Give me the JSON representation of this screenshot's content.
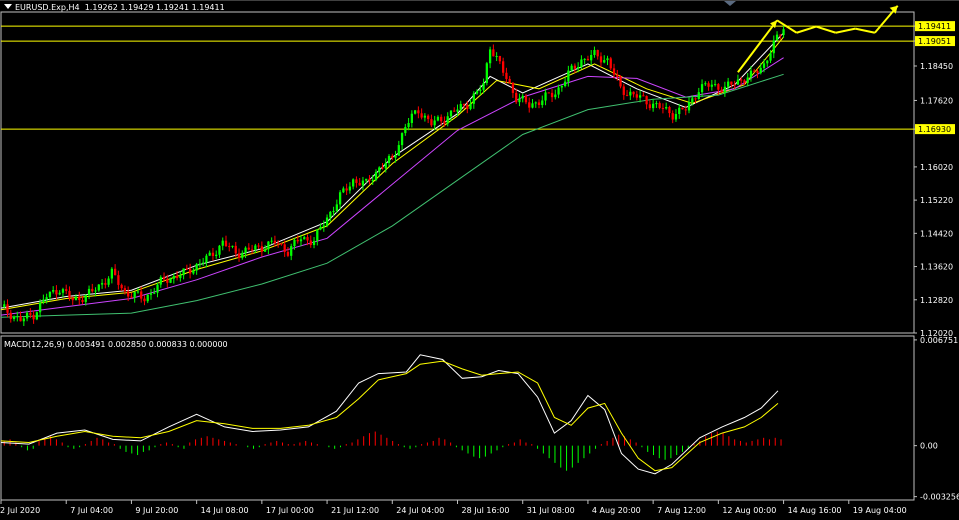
{
  "header": {
    "symbol": "EURUSD.Exp,H4",
    "ohlc": "1.19262 1.19429 1.19241 1.19411"
  },
  "macd_header": {
    "text": "MACD(12,26,9) 0.003491 0.002850 0.000833 0.000000"
  },
  "colors": {
    "background": "#000000",
    "bull": "#00ff00",
    "bear": "#ff0000",
    "ma_fast": "#ffffff",
    "ma_mid": "#ffff00",
    "ma_slow": "#cc44ff",
    "ma_long": "#40c070",
    "hline": "#ffff00",
    "price_label_bg": "#ffff00",
    "grid_frame": "#c0c0c0",
    "arrow": "#ffff00"
  },
  "chart_data": [
    {
      "type": "candlestick",
      "name": "price",
      "ylim": [
        1.1202,
        1.1975
      ],
      "y_ticks": [
        "1.19411",
        "1.19051",
        "1.18450",
        "1.17620",
        "1.16930",
        "1.16020",
        "1.15220",
        "1.14420",
        "1.13620",
        "1.12820",
        "1.12020"
      ],
      "x_tick_labels": [
        "2 Jul 2020",
        "7 Jul 04:00",
        "9 Jul 20:00",
        "14 Jul 08:00",
        "17 Jul 00:00",
        "21 Jul 12:00",
        "24 Jul 04:00",
        "28 Jul 16:00",
        "31 Jul 08:00",
        "4 Aug 20:00",
        "7 Aug 12:00",
        "12 Aug 00:00",
        "14 Aug 16:00",
        "19 Aug 04:00"
      ],
      "horizontal_lines": [
        1.1941,
        1.1905,
        1.1693
      ],
      "price_labels": [
        {
          "text": "1.19411",
          "value": 1.1941
        },
        {
          "text": "1.19051",
          "value": 1.1905
        },
        {
          "text": "1.16930",
          "value": 1.1693
        }
      ],
      "close_path": [
        [
          0,
          1.1265
        ],
        [
          6,
          1.1232
        ],
        [
          10,
          1.1248
        ],
        [
          14,
          1.129
        ],
        [
          18,
          1.131
        ],
        [
          22,
          1.128
        ],
        [
          28,
          1.13
        ],
        [
          34,
          1.1345
        ],
        [
          38,
          1.13
        ],
        [
          44,
          1.1285
        ],
        [
          50,
          1.133
        ],
        [
          56,
          1.1345
        ],
        [
          60,
          1.1365
        ],
        [
          64,
          1.1385
        ],
        [
          68,
          1.142
        ],
        [
          72,
          1.1395
        ],
        [
          78,
          1.1405
        ],
        [
          84,
          1.142
        ],
        [
          88,
          1.14
        ],
        [
          92,
          1.143
        ],
        [
          96,
          1.1425
        ],
        [
          100,
          1.148
        ],
        [
          104,
          1.153
        ],
        [
          108,
          1.157
        ],
        [
          112,
          1.156
        ],
        [
          116,
          1.16
        ],
        [
          120,
          1.162
        ],
        [
          124,
          1.17
        ],
        [
          128,
          1.174
        ],
        [
          132,
          1.1705
        ],
        [
          136,
          1.172
        ],
        [
          140,
          1.174
        ],
        [
          144,
          1.176
        ],
        [
          148,
          1.18
        ],
        [
          150,
          1.1895
        ],
        [
          154,
          1.183
        ],
        [
          158,
          1.177
        ],
        [
          162,
          1.175
        ],
        [
          166,
          1.1765
        ],
        [
          170,
          1.178
        ],
        [
          174,
          1.1825
        ],
        [
          178,
          1.186
        ],
        [
          182,
          1.187
        ],
        [
          186,
          1.186
        ],
        [
          190,
          1.179
        ],
        [
          194,
          1.1775
        ],
        [
          198,
          1.176
        ],
        [
          202,
          1.1745
        ],
        [
          206,
          1.173
        ],
        [
          210,
          1.174
        ],
        [
          214,
          1.179
        ],
        [
          218,
          1.18
        ],
        [
          222,
          1.179
        ],
        [
          226,
          1.181
        ],
        [
          230,
          1.182
        ],
        [
          234,
          1.185
        ],
        [
          236,
          1.188
        ],
        [
          240,
          1.1941
        ]
      ],
      "moving_averages": [
        {
          "role": "ma_fast",
          "points": [
            [
              0,
              1.1262
            ],
            [
              20,
              1.129
            ],
            [
              40,
              1.1305
            ],
            [
              60,
              1.1365
            ],
            [
              80,
              1.1405
            ],
            [
              100,
              1.147
            ],
            [
              120,
              1.1625
            ],
            [
              140,
              1.173
            ],
            [
              150,
              1.182
            ],
            [
              160,
              1.178
            ],
            [
              180,
              1.185
            ],
            [
              195,
              1.179
            ],
            [
              210,
              1.1745
            ],
            [
              225,
              1.18
            ],
            [
              240,
              1.1925
            ]
          ]
        },
        {
          "role": "ma_mid",
          "points": [
            [
              0,
              1.1258
            ],
            [
              20,
              1.1285
            ],
            [
              40,
              1.13
            ],
            [
              60,
              1.1355
            ],
            [
              80,
              1.14
            ],
            [
              100,
              1.146
            ],
            [
              120,
              1.161
            ],
            [
              140,
              1.1725
            ],
            [
              152,
              1.181
            ],
            [
              165,
              1.179
            ],
            [
              182,
              1.185
            ],
            [
              198,
              1.179
            ],
            [
              212,
              1.1755
            ],
            [
              228,
              1.18
            ],
            [
              240,
              1.1915
            ]
          ]
        },
        {
          "role": "ma_slow",
          "points": [
            [
              0,
              1.1245
            ],
            [
              20,
              1.1265
            ],
            [
              40,
              1.1285
            ],
            [
              60,
              1.133
            ],
            [
              80,
              1.1385
            ],
            [
              100,
              1.143
            ],
            [
              120,
              1.156
            ],
            [
              140,
              1.169
            ],
            [
              160,
              1.177
            ],
            [
              180,
              1.182
            ],
            [
              195,
              1.1815
            ],
            [
              210,
              1.177
            ],
            [
              225,
              1.179
            ],
            [
              240,
              1.1865
            ]
          ]
        },
        {
          "role": "ma_long",
          "points": [
            [
              0,
              1.124
            ],
            [
              20,
              1.1245
            ],
            [
              40,
              1.125
            ],
            [
              60,
              1.128
            ],
            [
              80,
              1.132
            ],
            [
              100,
              1.137
            ],
            [
              120,
              1.146
            ],
            [
              140,
              1.157
            ],
            [
              160,
              1.168
            ],
            [
              180,
              1.174
            ],
            [
              200,
              1.1765
            ],
            [
              220,
              1.1775
            ],
            [
              240,
              1.1825
            ]
          ]
        }
      ],
      "forecast_arrows": [
        [
          [
            226,
            1.183
          ],
          [
            238,
            1.1955
          ]
        ],
        [
          [
            238,
            1.1955
          ],
          [
            244,
            1.1925
          ]
        ],
        [
          [
            244,
            1.1925
          ],
          [
            250,
            1.194
          ]
        ],
        [
          [
            250,
            1.194
          ],
          [
            256,
            1.1925
          ]
        ],
        [
          [
            256,
            1.1925
          ],
          [
            262,
            1.1935
          ]
        ],
        [
          [
            262,
            1.1935
          ],
          [
            268,
            1.1925
          ]
        ],
        [
          [
            268,
            1.1925
          ],
          [
            275,
            1.199
          ]
        ]
      ]
    },
    {
      "type": "macd",
      "name": "MACD(12,26,9)",
      "ylim": [
        -0.00347,
        0.007
      ],
      "y_ticks": [
        "0.006751",
        "0.00",
        "-0.003256"
      ],
      "histogram": [
        0.0003,
        0.0004,
        0.0002,
        -0.0001,
        -0.0003,
        -0.0002,
        0.0003,
        0.0005,
        0.0006,
        0.0004,
        0.0002,
        -0.0001,
        -0.0002,
        -0.0001,
        0.0001,
        0.0003,
        0.0005,
        0.0004,
        0.0002,
        0.0001,
        -0.0002,
        -0.0004,
        -0.0005,
        -0.0006,
        -0.0004,
        -0.0003,
        -0.0001,
        0.0001,
        0.0002,
        0.0001,
        -0.0001,
        -0.0002,
        0.0002,
        0.0004,
        0.0005,
        0.0006,
        0.0005,
        0.0004,
        0.0003,
        0.0002,
        0.0001,
        0.0,
        -0.0001,
        -0.0002,
        -0.0001,
        0.0001,
        0.0002,
        0.0003,
        0.0002,
        0.0001,
        0.0001,
        0.0002,
        0.0003,
        0.0002,
        0.0001,
        0.0,
        -0.0001,
        -0.0002,
        -0.0001,
        0.0001,
        0.0002,
        0.0004,
        0.0006,
        0.0008,
        0.0009,
        0.0007,
        0.0005,
        0.0003,
        0.0001,
        -0.0001,
        -0.0002,
        -0.0001,
        0.0001,
        0.0002,
        0.0003,
        0.0005,
        0.0004,
        0.0002,
        -0.0001,
        -0.0003,
        -0.0005,
        -0.0007,
        -0.0008,
        -0.0007,
        -0.0005,
        -0.0003,
        -0.0001,
        0.0001,
        0.0002,
        0.0004,
        0.0002,
        0.0001,
        -0.0002,
        -0.0005,
        -0.0008,
        -0.0011,
        -0.0014,
        -0.0016,
        -0.0014,
        -0.0011,
        -0.0008,
        -0.0005,
        -0.0002,
        0.0001,
        0.0003,
        0.0005,
        0.0007,
        0.0006,
        0.0004,
        0.0002,
        -0.0001,
        -0.0004,
        -0.0006,
        -0.0008,
        -0.0009,
        -0.0008,
        -0.0006,
        -0.0004,
        -0.0002,
        0.0001,
        0.0003,
        0.0006,
        0.0008,
        0.0009,
        0.0008,
        0.0006,
        0.0004,
        0.0003,
        0.0002,
        0.0003,
        0.0004,
        0.0005,
        0.0004,
        0.0005,
        0.0004
      ],
      "macd_line": [
        [
          0,
          0.0002
        ],
        [
          10,
          0.0001
        ],
        [
          20,
          0.0008
        ],
        [
          30,
          0.001
        ],
        [
          40,
          0.0004
        ],
        [
          50,
          0.0003
        ],
        [
          60,
          0.0012
        ],
        [
          70,
          0.002
        ],
        [
          80,
          0.0012
        ],
        [
          90,
          0.0009
        ],
        [
          100,
          0.001
        ],
        [
          110,
          0.0012
        ],
        [
          120,
          0.0022
        ],
        [
          128,
          0.004
        ],
        [
          135,
          0.0046
        ],
        [
          145,
          0.0047
        ],
        [
          150,
          0.0058
        ],
        [
          158,
          0.0055
        ],
        [
          165,
          0.0043
        ],
        [
          172,
          0.0044
        ],
        [
          178,
          0.0048
        ],
        [
          185,
          0.0046
        ],
        [
          192,
          0.0031
        ],
        [
          198,
          0.0008
        ],
        [
          204,
          0.0016
        ],
        [
          210,
          0.0032
        ],
        [
          216,
          0.0023
        ],
        [
          222,
          -0.0005
        ],
        [
          228,
          -0.0015
        ],
        [
          234,
          -0.0018
        ],
        [
          240,
          -0.0012
        ],
        [
          250,
          0.0005
        ],
        [
          258,
          0.0012
        ],
        [
          266,
          0.0018
        ],
        [
          272,
          0.0024
        ],
        [
          278,
          0.0035
        ]
      ],
      "signal_line": [
        [
          0,
          0.0003
        ],
        [
          10,
          0.0002
        ],
        [
          20,
          0.0006
        ],
        [
          30,
          0.0009
        ],
        [
          40,
          0.0006
        ],
        [
          50,
          0.0005
        ],
        [
          60,
          0.0009
        ],
        [
          70,
          0.0016
        ],
        [
          80,
          0.0014
        ],
        [
          90,
          0.0011
        ],
        [
          100,
          0.0011
        ],
        [
          110,
          0.0013
        ],
        [
          120,
          0.0018
        ],
        [
          128,
          0.003
        ],
        [
          135,
          0.0042
        ],
        [
          145,
          0.0046
        ],
        [
          150,
          0.0052
        ],
        [
          158,
          0.0054
        ],
        [
          165,
          0.0049
        ],
        [
          172,
          0.0045
        ],
        [
          178,
          0.0046
        ],
        [
          185,
          0.0047
        ],
        [
          192,
          0.004
        ],
        [
          198,
          0.0018
        ],
        [
          204,
          0.0013
        ],
        [
          210,
          0.0024
        ],
        [
          216,
          0.0027
        ],
        [
          222,
          0.0008
        ],
        [
          228,
          -0.0008
        ],
        [
          234,
          -0.0016
        ],
        [
          240,
          -0.0014
        ],
        [
          250,
          0.0002
        ],
        [
          258,
          0.0008
        ],
        [
          266,
          0.0012
        ],
        [
          272,
          0.0018
        ],
        [
          278,
          0.0027
        ]
      ]
    }
  ]
}
